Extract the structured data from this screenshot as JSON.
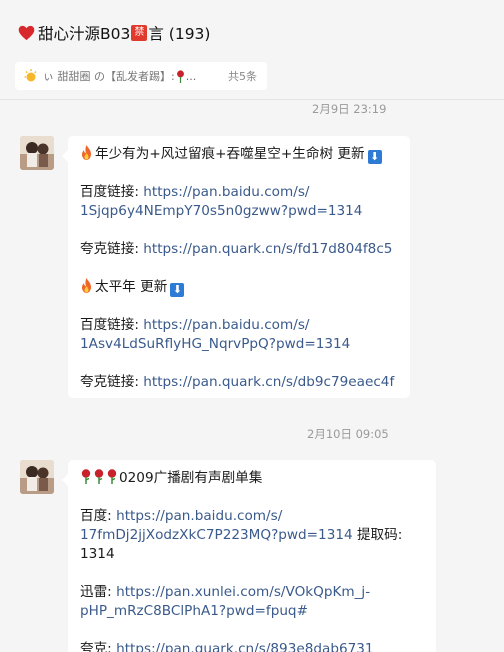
{
  "header": {
    "title_prefix": "甜心汁源B03",
    "title_badge": "禁",
    "title_suffix": "言 (193)",
    "notice_text": "ぃ 甜甜圈 の【乱发者踢】: ",
    "notice_more": "...",
    "notice_count": "共5条"
  },
  "messages": [
    {
      "time": "2月9日 23:19",
      "lines": [
        {
          "type": "title",
          "text": "年少有为+风过留痕+吞噬星空+生命树 更新",
          "icon": "fire-icon",
          "badge": "⬇"
        },
        {
          "type": "gap"
        },
        {
          "type": "text",
          "text": "百度链接: ",
          "link": "https://pan.baidu.com/s/"
        },
        {
          "type": "linkonly",
          "link": "1Sjqp6y4NEmpY70s5n0gzww?pwd=1314"
        },
        {
          "type": "gap"
        },
        {
          "type": "text",
          "text": "夸克链接: ",
          "link": "https://pan.quark.cn/s/fd17d804f8c5"
        },
        {
          "type": "gap"
        },
        {
          "type": "title",
          "text": "太平年 更新",
          "icon": "fire-icon",
          "badge": "⬇"
        },
        {
          "type": "gap"
        },
        {
          "type": "text",
          "text": "百度链接: ",
          "link": "https://pan.baidu.com/s/"
        },
        {
          "type": "linkonly",
          "link": "1Asv4LdSuRflyHG_NqrvPpQ?pwd=1314"
        },
        {
          "type": "gap"
        },
        {
          "type": "text",
          "text": "夸克链接: ",
          "link": "https://pan.quark.cn/s/db9c79eaec4f"
        }
      ]
    },
    {
      "time": "2月10日 09:05",
      "lines": [
        {
          "type": "roses",
          "text": "0209广播剧有声剧单集"
        },
        {
          "type": "gap"
        },
        {
          "type": "text",
          "text": "百度: ",
          "link": "https://pan.baidu.com/s/"
        },
        {
          "type": "linkthen",
          "link": "17fmDj2jjXodzXkC7P223MQ?pwd=1314",
          "after": " 提取码:"
        },
        {
          "type": "plain",
          "text": "1314"
        },
        {
          "type": "gap"
        },
        {
          "type": "text",
          "text": "迅雷: ",
          "link": "https://pan.xunlei.com/s/VOkQpKm_j-"
        },
        {
          "type": "linkonly",
          "link": "pHP_mRzC8BClPhA1?pwd=fpuq#"
        },
        {
          "type": "gap"
        },
        {
          "type": "text",
          "text": "夸克: ",
          "link": "https://pan.quark.cn/s/893e8dab6731"
        }
      ]
    }
  ]
}
